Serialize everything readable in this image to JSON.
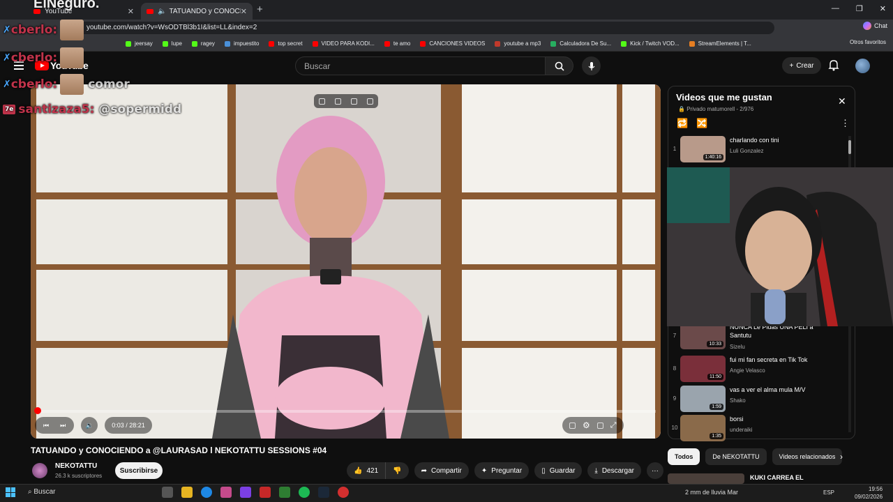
{
  "browser": {
    "tabs": [
      {
        "label": "YouTube",
        "active": false
      },
      {
        "label": "TATUANDO y CONOCIENDO",
        "active": true
      }
    ],
    "url": "youtube.com/watch?v=WsODTBl3b1I&list=LL&index=2",
    "chat_label": "Chat",
    "bookmarks": [
      "jeersay",
      "lupe",
      "ragey",
      "impuestito",
      "top secret",
      "VIDEO PARA KODI...",
      "te amo",
      "CANCIONES VIDEOS",
      "youtube a mp3",
      "Calculadora De Su...",
      "Kick / Twitch VOD...",
      "StreamElements | T..."
    ],
    "other_bookmarks": "Otros favoritos"
  },
  "youtube": {
    "logo": "YouTube",
    "search_placeholder": "Buscar",
    "create_label": "Crear"
  },
  "player": {
    "time": "0:03 / 28:21",
    "progress": 0.002
  },
  "video": {
    "title": "TATUANDO y CONOCIENDO a @LAURASAD l NEKOTATTU SESSIONS #04",
    "channel": "NEKOTATTU",
    "subscribers": "26.3 k suscriptores",
    "subscribe_label": "Suscribirse",
    "likes": "421",
    "share_label": "Compartir",
    "ask_label": "Preguntar",
    "save_label": "Guardar",
    "download_label": "Descargar"
  },
  "playlist": {
    "title": "Videos que me gustan",
    "meta": "Privado matumorell - 2/976",
    "items": [
      {
        "index": "1",
        "title": "charlando con tini",
        "channel": "Luli Gonzalez",
        "duration": "1:40:16",
        "color": "#b89a8a"
      },
      {
        "index": "7",
        "title": "NUNCA Le Pidas UNA PELI a Santutu",
        "channel": "Sizelu",
        "duration": "10:33",
        "color": "#6b4a4a"
      },
      {
        "index": "8",
        "title": "fui mi fan secreta en Tik Tok",
        "channel": "Angie Velasco",
        "duration": "11:50",
        "color": "#7a2f3a"
      },
      {
        "index": "9",
        "title": "vas a ver el alma mula M/V",
        "channel": "Shako",
        "duration": "1:59",
        "color": "#9aa4ad"
      },
      {
        "index": "10",
        "title": "borsi",
        "channel": "underaiki",
        "duration": "1:35",
        "color": "#8a6a4a"
      }
    ]
  },
  "chips": [
    "Todos",
    "De NEKOTATTU",
    "Videos relacionados"
  ],
  "next_recommendation": "KUKI CARREA EL",
  "stream_chat": [
    {
      "user": "cberlo:",
      "text": ""
    },
    {
      "user": "cberlo:",
      "text": ""
    },
    {
      "user": "cberlo:",
      "text": "comor"
    },
    {
      "user": "santizaza5:",
      "text": "@sopermidd"
    }
  ],
  "overlay_title": "ElNeguro.",
  "taskbar": {
    "search": "Buscar",
    "weather": "2 mm de lluvia Mar",
    "lang": "ESP",
    "time": "19:56",
    "date": "09/02/2026"
  }
}
